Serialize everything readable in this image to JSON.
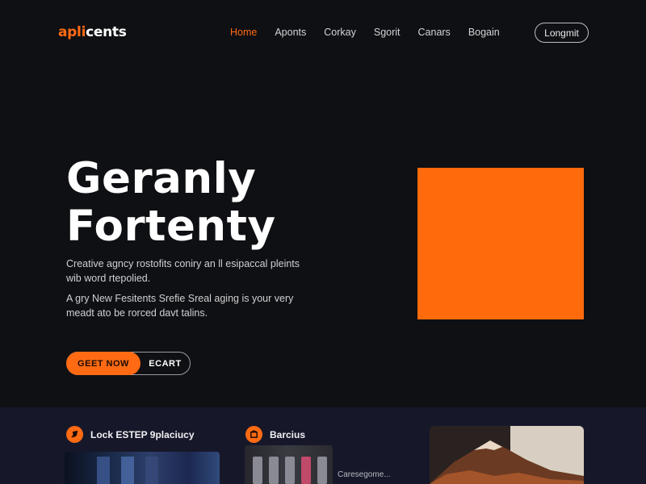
{
  "brand": {
    "accent": "apli",
    "rest": "cents"
  },
  "nav": {
    "items": [
      {
        "label": "Home",
        "active": true
      },
      {
        "label": "Aponts",
        "active": false
      },
      {
        "label": "Corkay",
        "active": false
      },
      {
        "label": "Sgorit",
        "active": false
      },
      {
        "label": "Canars",
        "active": false
      },
      {
        "label": "Bogain",
        "active": false
      }
    ],
    "login_label": "Longmit"
  },
  "hero": {
    "title_line1": "Geranly",
    "title_line2": "Fortenty",
    "description": "Creative agncy rostofits coniry an ll esipaccal pleints wib word rtepolied.",
    "description2": "A gry New Fesitents Srefie Sreal aging is your very meadt ato be rorced davt talins.",
    "cta_primary": "GEET NOW",
    "cta_secondary": "ECART"
  },
  "features": [
    {
      "label": "Lock ESTEP 9placiucy",
      "icon": "rocket-icon"
    },
    {
      "label": "Barcius",
      "icon": "box-icon"
    }
  ],
  "thumbnails": {
    "caption": "Caresegome..."
  },
  "colors": {
    "accent": "#ff6a13",
    "background": "#0f1013",
    "section": "#16182a"
  }
}
